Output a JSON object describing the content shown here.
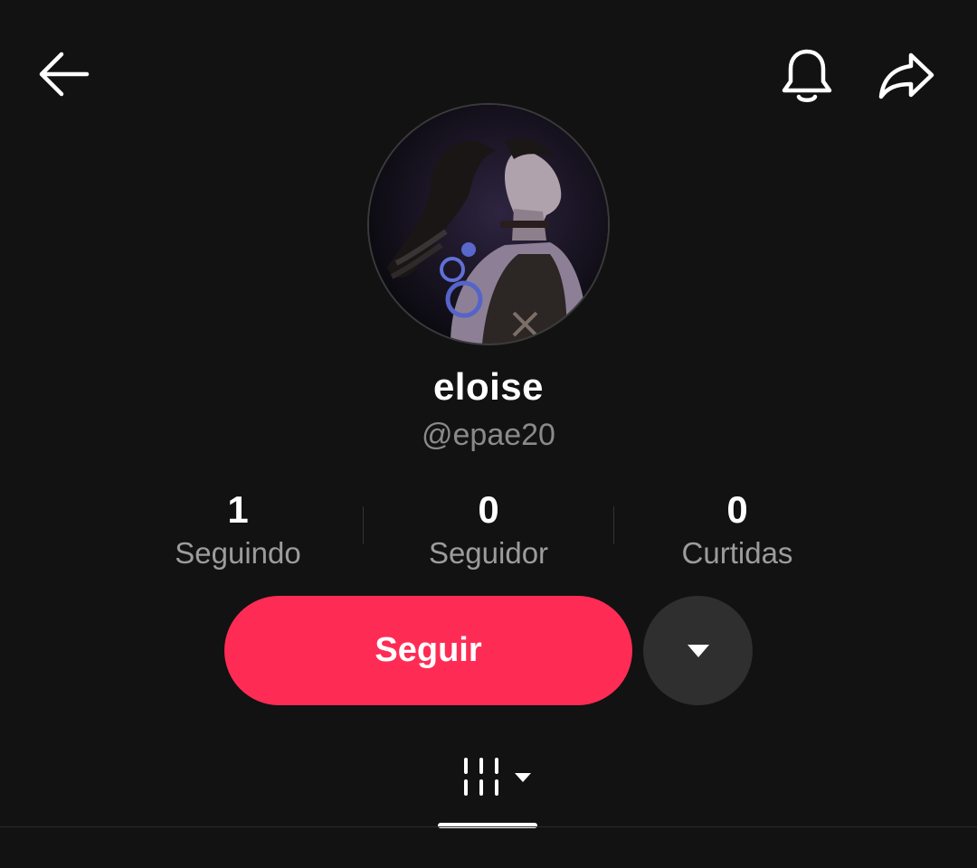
{
  "header": {
    "back_icon": "arrow-left-icon",
    "notification_icon": "bell-icon",
    "share_icon": "share-arrow-icon"
  },
  "profile": {
    "display_name": "eloise",
    "handle": "@epae20",
    "avatar_description": "avatar"
  },
  "stats": [
    {
      "value": "1",
      "label": "Seguindo"
    },
    {
      "value": "0",
      "label": "Seguidor"
    },
    {
      "value": "0",
      "label": "Curtidas"
    }
  ],
  "actions": {
    "follow_label": "Seguir",
    "more_icon": "caret-down-icon"
  },
  "tabs": {
    "videos_icon": "grid-sort-icon",
    "dropdown_icon": "caret-down-icon"
  },
  "colors": {
    "background": "#121212",
    "accent": "#fe2c55",
    "secondary_text": "#8a8a8a",
    "more_button": "#2f2f2f"
  }
}
